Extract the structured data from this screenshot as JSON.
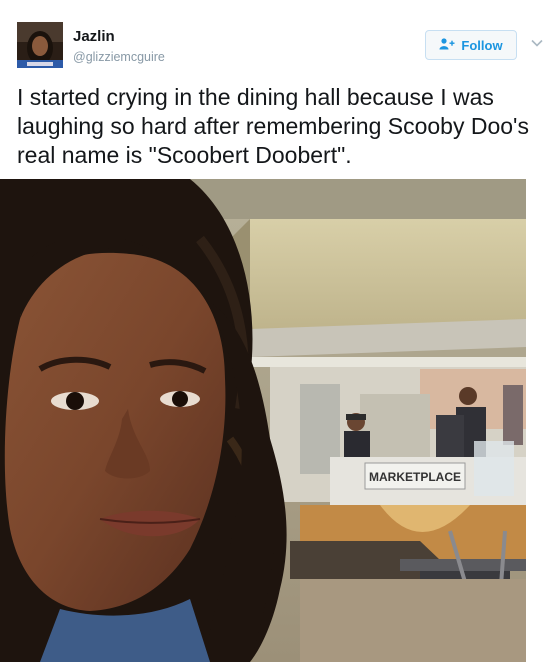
{
  "tweet": {
    "display_name": "Jazlin",
    "handle": "@glizziemcguire",
    "follow_label": "Follow",
    "text": "I started crying in the dining hall because I was laughing so hard after remembering Scooby Doo's real name is \"Scoobert Doobert\".",
    "avatar_icon": "avatar-photo",
    "follow_icon": "add-user-icon",
    "caret_icon": "chevron-down-icon"
  },
  "photo": {
    "sign_text": "MARKETPLACE"
  },
  "colors": {
    "accent": "#1b95e0",
    "text": "#14171a",
    "muted": "#8899a6"
  }
}
